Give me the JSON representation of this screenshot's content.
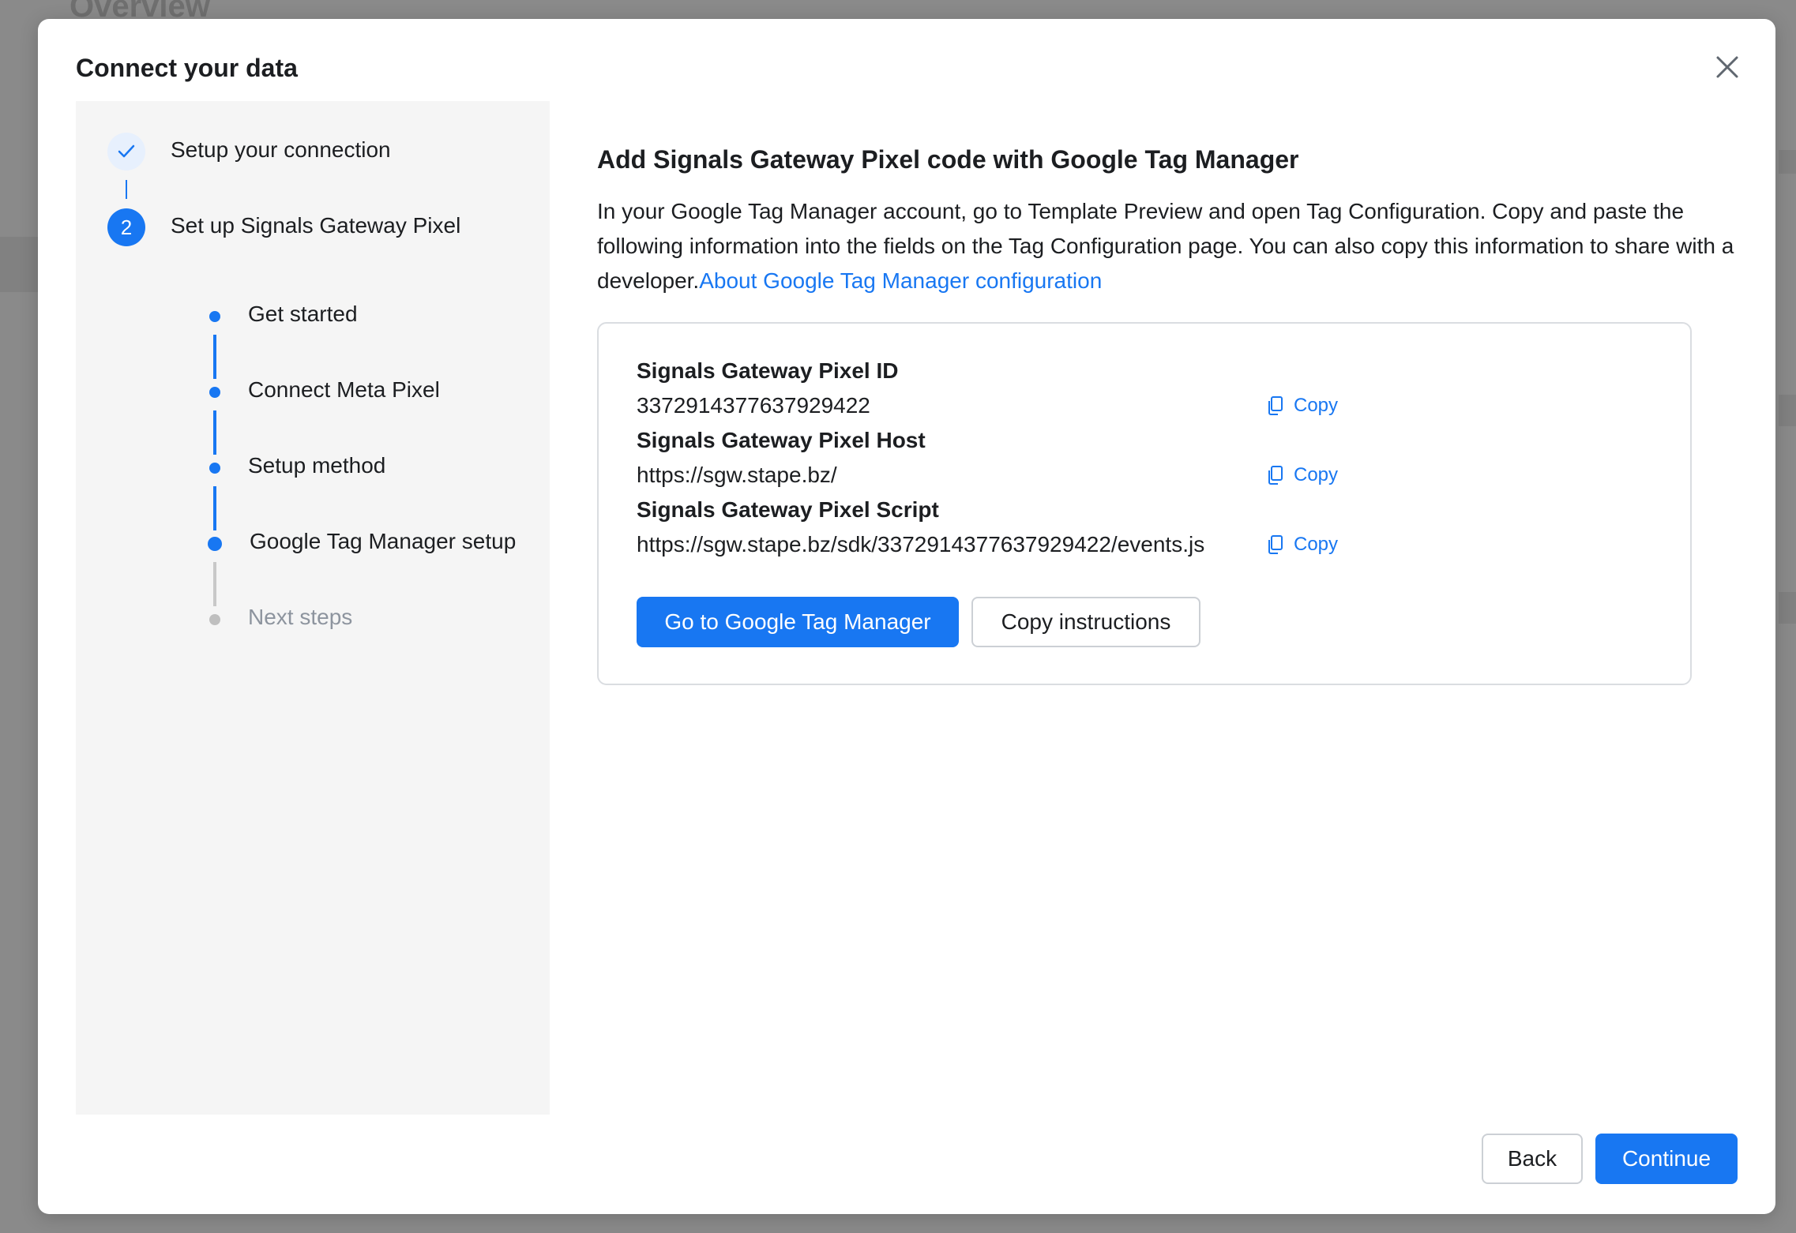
{
  "background": {
    "page_title": "Overview"
  },
  "modal": {
    "title": "Connect your data"
  },
  "stepper": {
    "steps": [
      {
        "label": "Setup your connection"
      },
      {
        "label": "Set up Signals Gateway Pixel",
        "number": "2"
      }
    ],
    "substeps": [
      {
        "label": "Get started"
      },
      {
        "label": "Connect Meta Pixel"
      },
      {
        "label": "Setup method"
      },
      {
        "label": "Google Tag Manager setup"
      },
      {
        "label": "Next steps"
      }
    ]
  },
  "content": {
    "heading": "Add Signals Gateway Pixel code with Google Tag Manager",
    "description": "In your Google Tag Manager account, go to Template Preview and open Tag Configuration. Copy and paste the following information into the fields on the Tag Configuration page. You can also copy this information to share with a developer.",
    "help_link": "About Google Tag Manager configuration",
    "fields": [
      {
        "label": "Signals Gateway Pixel ID",
        "value": "3372914377637929422",
        "copy_label": "Copy"
      },
      {
        "label": "Signals Gateway Pixel Host",
        "value": "https://sgw.stape.bz/",
        "copy_label": "Copy"
      },
      {
        "label": "Signals Gateway Pixel Script",
        "value": "https://sgw.stape.bz/sdk/3372914377637929422/events.js",
        "copy_label": "Copy"
      }
    ],
    "primary_button": "Go to Google Tag Manager",
    "secondary_button": "Copy instructions"
  },
  "footer": {
    "back_label": "Back",
    "continue_label": "Continue"
  },
  "colors": {
    "accent": "#1877f2",
    "text": "#1c1e21",
    "muted": "#8d949e",
    "overlay": "#8a8a8a"
  }
}
